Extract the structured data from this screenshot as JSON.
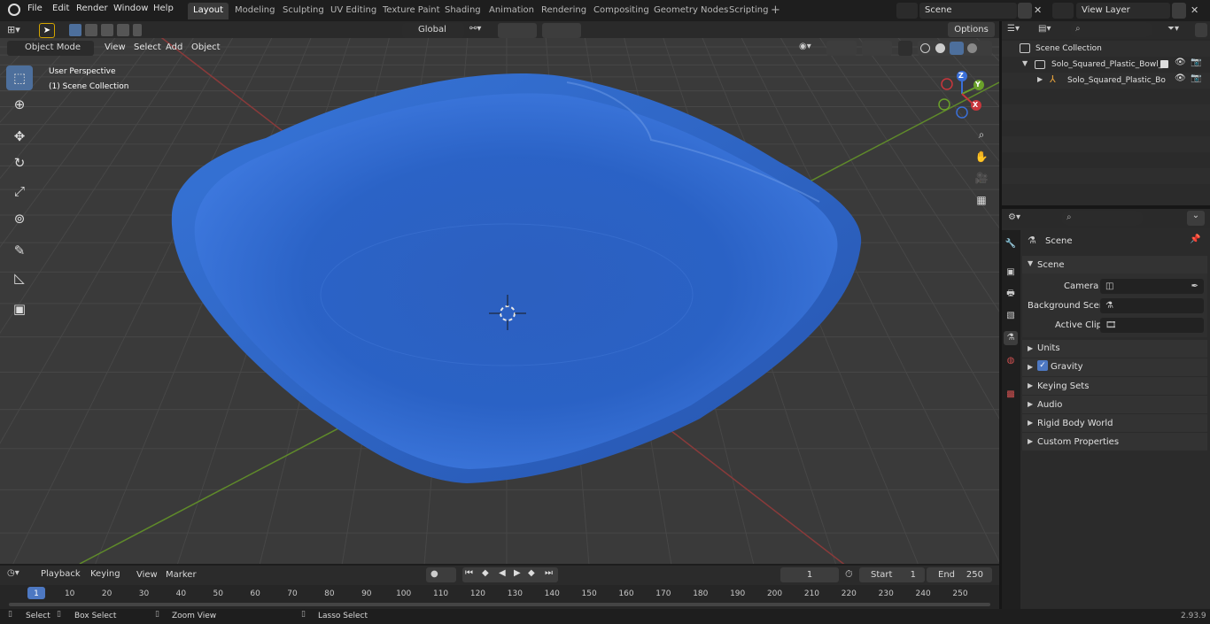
{
  "menu": {
    "file": "File",
    "edit": "Edit",
    "render": "Render",
    "window": "Window",
    "help": "Help"
  },
  "workspaces": [
    "Layout",
    "Modeling",
    "Sculpting",
    "UV Editing",
    "Texture Paint",
    "Shading",
    "Animation",
    "Rendering",
    "Compositing",
    "Geometry Nodes",
    "Scripting"
  ],
  "active_workspace": "Layout",
  "scene_field": "Scene",
  "view_layer_field": "View Layer",
  "header": {
    "transform_orientation": "Global",
    "options": "Options"
  },
  "viewport": {
    "mode": "Object Mode",
    "view": "View",
    "select": "Select",
    "add": "Add",
    "object": "Object",
    "perspective_label": "User Perspective",
    "collection_label": "(1) Scene Collection",
    "bowl_color": "#2a62c6"
  },
  "gizmo": {
    "x": "X",
    "y": "Y",
    "z": "Z"
  },
  "outliner": {
    "scene_collection": "Scene Collection",
    "item1": "Solo_Squared_Plastic_Bowl_B",
    "item2": "Solo_Squared_Plastic_Bo"
  },
  "properties": {
    "context": "Scene",
    "section": "Scene",
    "camera_label": "Camera",
    "background_label": "Background Scene",
    "clip_label": "Active Clip",
    "units": "Units",
    "gravity": "Gravity",
    "gravity_checked": true,
    "keying_sets": "Keying Sets",
    "audio": "Audio",
    "rigid_body": "Rigid Body World",
    "custom_props": "Custom Properties"
  },
  "timeline": {
    "playback": "Playback",
    "keying": "Keying",
    "view": "View",
    "marker": "Marker",
    "current_frame": "1",
    "start_label": "Start",
    "start": "1",
    "end_label": "End",
    "end": "250",
    "ticks": [
      "1",
      "10",
      "20",
      "30",
      "40",
      "50",
      "60",
      "70",
      "80",
      "90",
      "100",
      "110",
      "120",
      "130",
      "140",
      "150",
      "160",
      "170",
      "180",
      "190",
      "200",
      "210",
      "220",
      "230",
      "240",
      "250"
    ]
  },
  "status": {
    "select": "Select",
    "box_select": "Box Select",
    "zoom_view": "Zoom View",
    "lasso_select": "Lasso Select",
    "version": "2.93.9"
  }
}
